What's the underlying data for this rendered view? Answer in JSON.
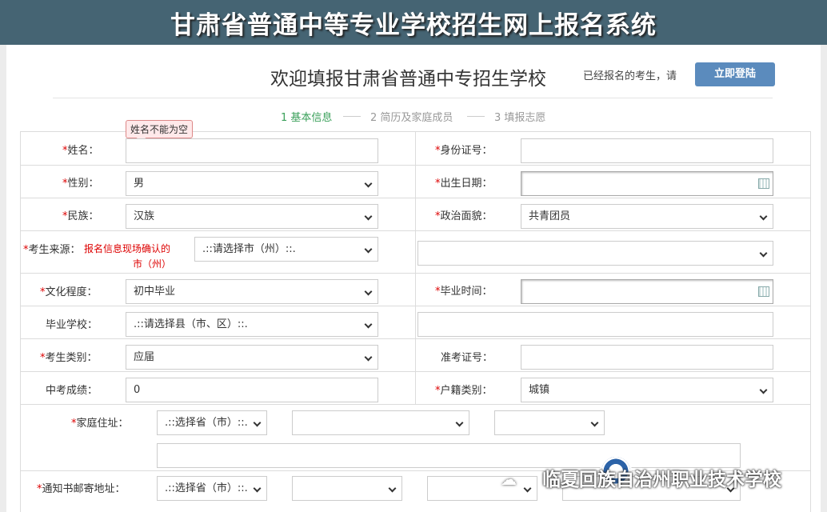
{
  "header": {
    "title": "甘肃省普通中等专业学校招生网上报名系统"
  },
  "top": {
    "welcome": "欢迎填报甘肃省普通中专招生学校",
    "registered_text": "已经报名的考生，请",
    "login_label": "立即登陆"
  },
  "steps": [
    {
      "label": "1 基本信息",
      "active": true
    },
    {
      "label": "2 简历及家庭成员",
      "active": false
    },
    {
      "label": "3 填报志愿",
      "active": false
    }
  ],
  "validation": {
    "name_error": "姓名不能为空"
  },
  "form": {
    "req_mark": "*",
    "name": {
      "label": "姓名：",
      "value": ""
    },
    "id_number": {
      "label": "身份证号：",
      "value": ""
    },
    "gender": {
      "label": "性别：",
      "value": "男"
    },
    "birthdate": {
      "label": "出生日期：",
      "value": ""
    },
    "ethnicity": {
      "label": "民族：",
      "value": "汉族"
    },
    "political": {
      "label": "政治面貌：",
      "value": "共青团员"
    },
    "source": {
      "label": "考生来源：",
      "note_line1": "报名信息现场确认的",
      "note_line2": "市（州）",
      "city_value": ".::请选择市（州）::.",
      "county_value": ""
    },
    "education": {
      "label": "文化程度：",
      "value": "初中毕业"
    },
    "grad_time": {
      "label": "毕业时间：",
      "value": ""
    },
    "school": {
      "label": "毕业学校：",
      "county_value": ".::请选择县（市、区）::.",
      "school_value": ""
    },
    "student_type": {
      "label": "考生类别：",
      "value": "应届"
    },
    "exam_number": {
      "label": "准考证号：",
      "value": ""
    },
    "score": {
      "label": "中考成绩：",
      "value": "0"
    },
    "household": {
      "label": "户籍类别：",
      "value": "城镇"
    },
    "home_address": {
      "label": "家庭住址：",
      "province_value": ".::选择省（市）::.",
      "city_value": "",
      "county_value": "",
      "detail_value": ""
    },
    "mail_address": {
      "label": "通知书邮寄地址：",
      "province_value": ".::选择省（市）::.",
      "city_value": "",
      "county_value": "",
      "town_value": ""
    }
  },
  "watermark": {
    "wechat_glyph": "☁",
    "text": "临夏回族自治州职业技术学校"
  }
}
